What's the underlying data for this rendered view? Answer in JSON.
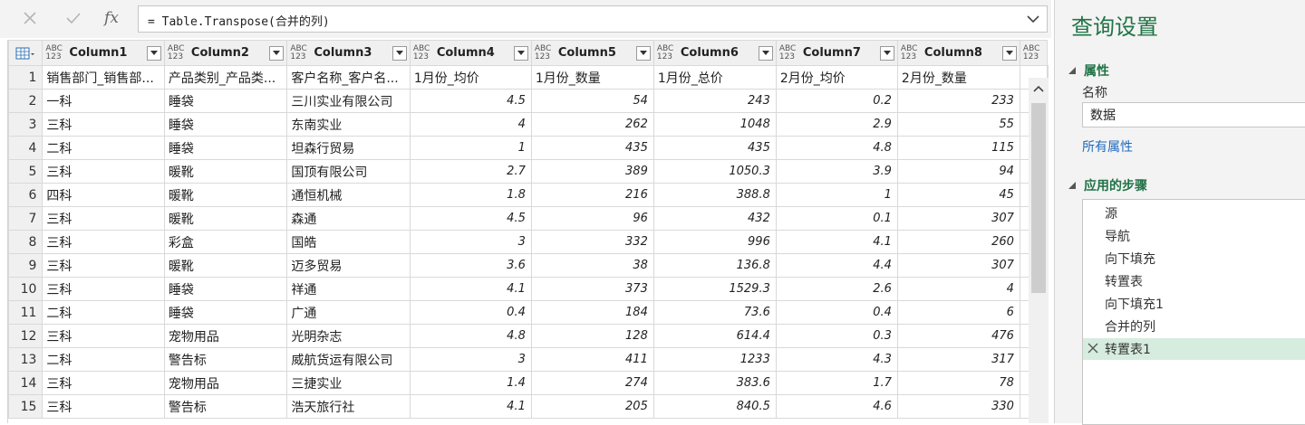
{
  "formula_bar": {
    "cancel_icon": "x-icon",
    "confirm_icon": "check-icon",
    "fx_label": "fx",
    "formula": "= Table.Transpose(合并的列)"
  },
  "grid": {
    "columns": [
      {
        "type": "ABC\n123",
        "name": "Column1"
      },
      {
        "type": "ABC\n123",
        "name": "Column2"
      },
      {
        "type": "ABC\n123",
        "name": "Column3"
      },
      {
        "type": "ABC\n123",
        "name": "Column4"
      },
      {
        "type": "ABC\n123",
        "name": "Column5"
      },
      {
        "type": "ABC\n123",
        "name": "Column6"
      },
      {
        "type": "ABC\n123",
        "name": "Column7"
      },
      {
        "type": "ABC\n123",
        "name": "Column8"
      },
      {
        "type": "ABC\n123",
        "name": ""
      }
    ],
    "rows": [
      {
        "n": "1",
        "cells": [
          "销售部门_销售部...",
          "产品类别_产品类...",
          "客户名称_客户名...",
          "1月份_均价",
          "1月份_数量",
          "1月份_总价",
          "2月份_均价",
          "2月份_数量"
        ]
      },
      {
        "n": "2",
        "cells": [
          "一科",
          "睡袋",
          "三川实业有限公司",
          "4.5",
          "54",
          "243",
          "0.2",
          "233"
        ]
      },
      {
        "n": "3",
        "cells": [
          "三科",
          "睡袋",
          "东南实业",
          "4",
          "262",
          "1048",
          "2.9",
          "55"
        ]
      },
      {
        "n": "4",
        "cells": [
          "二科",
          "睡袋",
          "坦森行贸易",
          "1",
          "435",
          "435",
          "4.8",
          "115"
        ]
      },
      {
        "n": "5",
        "cells": [
          "三科",
          "暖靴",
          "国顶有限公司",
          "2.7",
          "389",
          "1050.3",
          "3.9",
          "94"
        ]
      },
      {
        "n": "6",
        "cells": [
          "四科",
          "暖靴",
          "通恒机械",
          "1.8",
          "216",
          "388.8",
          "1",
          "45"
        ]
      },
      {
        "n": "7",
        "cells": [
          "三科",
          "暖靴",
          "森通",
          "4.5",
          "96",
          "432",
          "0.1",
          "307"
        ]
      },
      {
        "n": "8",
        "cells": [
          "三科",
          "彩盒",
          "国皓",
          "3",
          "332",
          "996",
          "4.1",
          "260"
        ]
      },
      {
        "n": "9",
        "cells": [
          "三科",
          "暖靴",
          "迈多贸易",
          "3.6",
          "38",
          "136.8",
          "4.4",
          "307"
        ]
      },
      {
        "n": "10",
        "cells": [
          "三科",
          "睡袋",
          "祥通",
          "4.1",
          "373",
          "1529.3",
          "2.6",
          "4"
        ]
      },
      {
        "n": "11",
        "cells": [
          "二科",
          "睡袋",
          "广通",
          "0.4",
          "184",
          "73.6",
          "0.4",
          "6"
        ]
      },
      {
        "n": "12",
        "cells": [
          "三科",
          "宠物用品",
          "光明杂志",
          "4.8",
          "128",
          "614.4",
          "0.3",
          "476"
        ]
      },
      {
        "n": "13",
        "cells": [
          "二科",
          "警告标",
          "威航货运有限公司",
          "3",
          "411",
          "1233",
          "4.3",
          "317"
        ]
      },
      {
        "n": "14",
        "cells": [
          "三科",
          "宠物用品",
          "三捷实业",
          "1.4",
          "274",
          "383.6",
          "1.7",
          "78"
        ]
      },
      {
        "n": "15",
        "cells": [
          "三科",
          "警告标",
          "浩天旅行社",
          "4.1",
          "205",
          "840.5",
          "4.6",
          "330"
        ]
      }
    ]
  },
  "panel": {
    "title": "查询设置",
    "properties_header": "属性",
    "name_label": "名称",
    "name_value": "数据",
    "all_properties_link": "所有属性",
    "steps_header": "应用的步骤",
    "steps": [
      "源",
      "导航",
      "向下填充",
      "转置表",
      "向下填充1",
      "合并的列",
      "转置表1"
    ],
    "selected_step": 6,
    "accent_color": "#217346"
  }
}
